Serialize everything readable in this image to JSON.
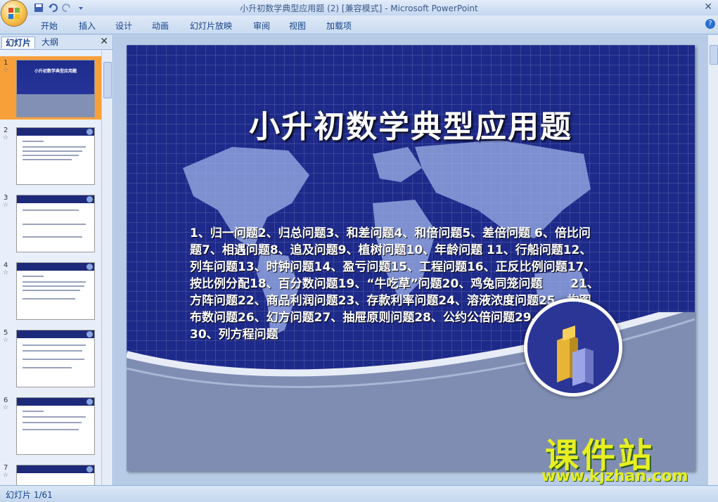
{
  "window": {
    "title": "小升初数学典型应用题 (2) [兼容模式] - Microsoft PowerPoint"
  },
  "ribbon": {
    "tabs": [
      "开始",
      "插入",
      "设计",
      "动画",
      "幻灯片放映",
      "审阅",
      "视图",
      "加载项"
    ]
  },
  "pane": {
    "tabs": [
      "幻灯片",
      "大纲"
    ],
    "slide_numbers": [
      "1",
      "2",
      "3",
      "4",
      "5",
      "6",
      "7"
    ],
    "first_thumb_title": "小升初数学典型应用题"
  },
  "slide": {
    "title": "小升初数学典型应用题",
    "body": "1、归一问题2、归总问题3、和差问题4、和倍问题5、差倍问题 6、倍比问题7、相遇问题8、追及问题9、植树问题10、年龄问题 11、行船问题12、列车问题13、时钟问题14、盈亏问题15、工程问题16、正反比例问题17、按比例分配18、百分数问题19、“牛吃草”问题20、鸡兔同笼问题　　 21、方阵问题22、商品利润问题23、存款利率问题24、溶液浓度问题25、构图布数问题26、幻方问题27、抽屉原则问题28、公约公倍问题29、最值问题30、列方程问题"
  },
  "watermark": {
    "text": "课件站",
    "url": "www.kjzhan.com"
  },
  "status": {
    "text": "幻灯片 1/61"
  },
  "colors": {
    "slide_bg": "#1e2a8a",
    "selected_thumb": "#f7a03a",
    "watermark": "#e7ef22"
  }
}
